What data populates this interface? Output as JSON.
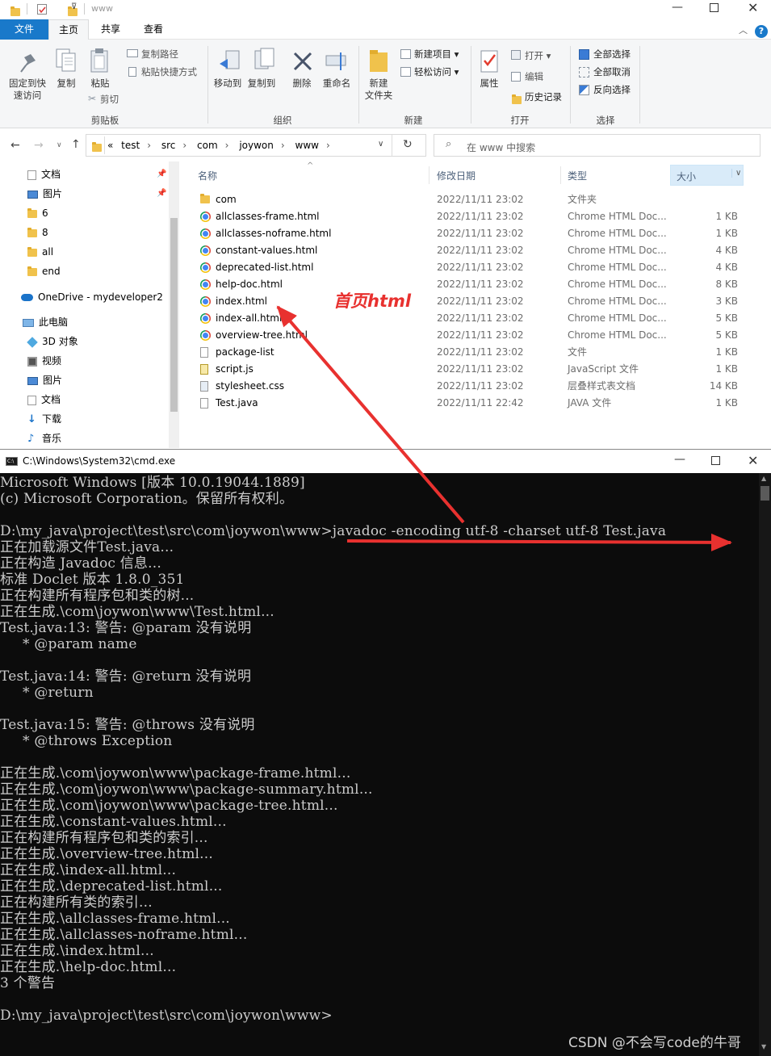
{
  "explorer": {
    "title": "www",
    "tabs": [
      {
        "label": "文件"
      },
      {
        "label": "主页"
      },
      {
        "label": "共享"
      },
      {
        "label": "查看"
      }
    ],
    "ribbon": {
      "pin_label_1": "固定到快",
      "pin_label_2": "速访问",
      "copy_label": "复制",
      "paste_label": "粘贴",
      "copy_path": "复制路径",
      "paste_shortcut": "粘贴快捷方式",
      "cut": "剪切",
      "clipboard_group": "剪贴板",
      "move_to": "移动到",
      "copy_to": "复制到",
      "delete": "删除",
      "rename": "重命名",
      "organize_group": "组织",
      "new_folder_1": "新建",
      "new_folder_2": "文件夹",
      "new_item": "新建项目",
      "easy_access": "轻松访问",
      "new_group": "新建",
      "properties": "属性",
      "open": "打开",
      "edit": "编辑",
      "history": "历史记录",
      "open_group": "打开",
      "select_all": "全部选择",
      "select_none": "全部取消",
      "invert_selection": "反向选择",
      "select_group": "选择"
    },
    "breadcrumb": {
      "overflow": "«",
      "items": [
        "test",
        "src",
        "com",
        "joywon",
        "www"
      ]
    },
    "search_placeholder": "在 www 中搜索",
    "nav": [
      {
        "label": "文档"
      },
      {
        "label": "图片"
      },
      {
        "label": "6"
      },
      {
        "label": "8"
      },
      {
        "label": "all"
      },
      {
        "label": "end"
      },
      {
        "label": "OneDrive - mydeveloper2"
      },
      {
        "label": "此电脑"
      },
      {
        "label": "3D 对象"
      },
      {
        "label": "视频"
      },
      {
        "label": "图片"
      },
      {
        "label": "文档"
      },
      {
        "label": "下载"
      },
      {
        "label": "音乐"
      }
    ],
    "columns": {
      "name": "名称",
      "date": "修改日期",
      "type": "类型",
      "size": "大小"
    },
    "files": [
      {
        "name": "com",
        "date": "2022/11/11 23:02",
        "type": "文件夹",
        "size": "",
        "icon": "folder-icon"
      },
      {
        "name": "allclasses-frame.html",
        "date": "2022/11/11 23:02",
        "type": "Chrome HTML Doc...",
        "size": "1 KB",
        "icon": "chrome-icon"
      },
      {
        "name": "allclasses-noframe.html",
        "date": "2022/11/11 23:02",
        "type": "Chrome HTML Doc...",
        "size": "1 KB",
        "icon": "chrome-icon"
      },
      {
        "name": "constant-values.html",
        "date": "2022/11/11 23:02",
        "type": "Chrome HTML Doc...",
        "size": "4 KB",
        "icon": "chrome-icon"
      },
      {
        "name": "deprecated-list.html",
        "date": "2022/11/11 23:02",
        "type": "Chrome HTML Doc...",
        "size": "4 KB",
        "icon": "chrome-icon"
      },
      {
        "name": "help-doc.html",
        "date": "2022/11/11 23:02",
        "type": "Chrome HTML Doc...",
        "size": "8 KB",
        "icon": "chrome-icon"
      },
      {
        "name": "index.html",
        "date": "2022/11/11 23:02",
        "type": "Chrome HTML Doc...",
        "size": "3 KB",
        "icon": "chrome-icon"
      },
      {
        "name": "index-all.html",
        "date": "2022/11/11 23:02",
        "type": "Chrome HTML Doc...",
        "size": "5 KB",
        "icon": "chrome-icon"
      },
      {
        "name": "overview-tree.html",
        "date": "2022/11/11 23:02",
        "type": "Chrome HTML Doc...",
        "size": "5 KB",
        "icon": "chrome-icon"
      },
      {
        "name": "package-list",
        "date": "2022/11/11 23:02",
        "type": "文件",
        "size": "1 KB",
        "icon": "file-icon"
      },
      {
        "name": "script.js",
        "date": "2022/11/11 23:02",
        "type": "JavaScript 文件",
        "size": "1 KB",
        "icon": "js-file-icon"
      },
      {
        "name": "stylesheet.css",
        "date": "2022/11/11 23:02",
        "type": "层叠样式表文档",
        "size": "14 KB",
        "icon": "css-file-icon"
      },
      {
        "name": "Test.java",
        "date": "2022/11/11 22:42",
        "type": "JAVA 文件",
        "size": "1 KB",
        "icon": "file-icon"
      }
    ]
  },
  "annotation": "首页html",
  "cmd": {
    "title": "C:\\Windows\\System32\\cmd.exe",
    "lines": [
      "Microsoft Windows [版本 10.0.19044.1889]",
      "(c) Microsoft Corporation。保留所有权利。",
      "",
      "D:\\my_java\\project\\test\\src\\com\\joywon\\www>javadoc -encoding utf-8 -charset utf-8 Test.java",
      "正在加载源文件Test.java...",
      "正在构造 Javadoc 信息...",
      "标准 Doclet 版本 1.8.0_351",
      "正在构建所有程序包和类的树...",
      "正在生成.\\com\\joywon\\www\\Test.html...",
      "Test.java:13: 警告: @param 没有说明",
      "     * @param name",
      "",
      "Test.java:14: 警告: @return 没有说明",
      "     * @return",
      "",
      "Test.java:15: 警告: @throws 没有说明",
      "     * @throws Exception",
      "",
      "正在生成.\\com\\joywon\\www\\package-frame.html...",
      "正在生成.\\com\\joywon\\www\\package-summary.html...",
      "正在生成.\\com\\joywon\\www\\package-tree.html...",
      "正在生成.\\constant-values.html...",
      "正在构建所有程序包和类的索引...",
      "正在生成.\\overview-tree.html...",
      "正在生成.\\index-all.html...",
      "正在生成.\\deprecated-list.html...",
      "正在构建所有类的索引...",
      "正在生成.\\allclasses-frame.html...",
      "正在生成.\\allclasses-noframe.html...",
      "正在生成.\\index.html...",
      "正在生成.\\help-doc.html...",
      "3 个警告",
      "",
      "D:\\my_java\\project\\test\\src\\com\\joywon\\www>"
    ]
  },
  "watermark": "CSDN @不会写code的牛哥",
  "colors": {
    "accent": "#0063b1",
    "arrow": "#e8312f",
    "console_bg": "#0c0c0c",
    "console_fg": "#cccccc"
  }
}
